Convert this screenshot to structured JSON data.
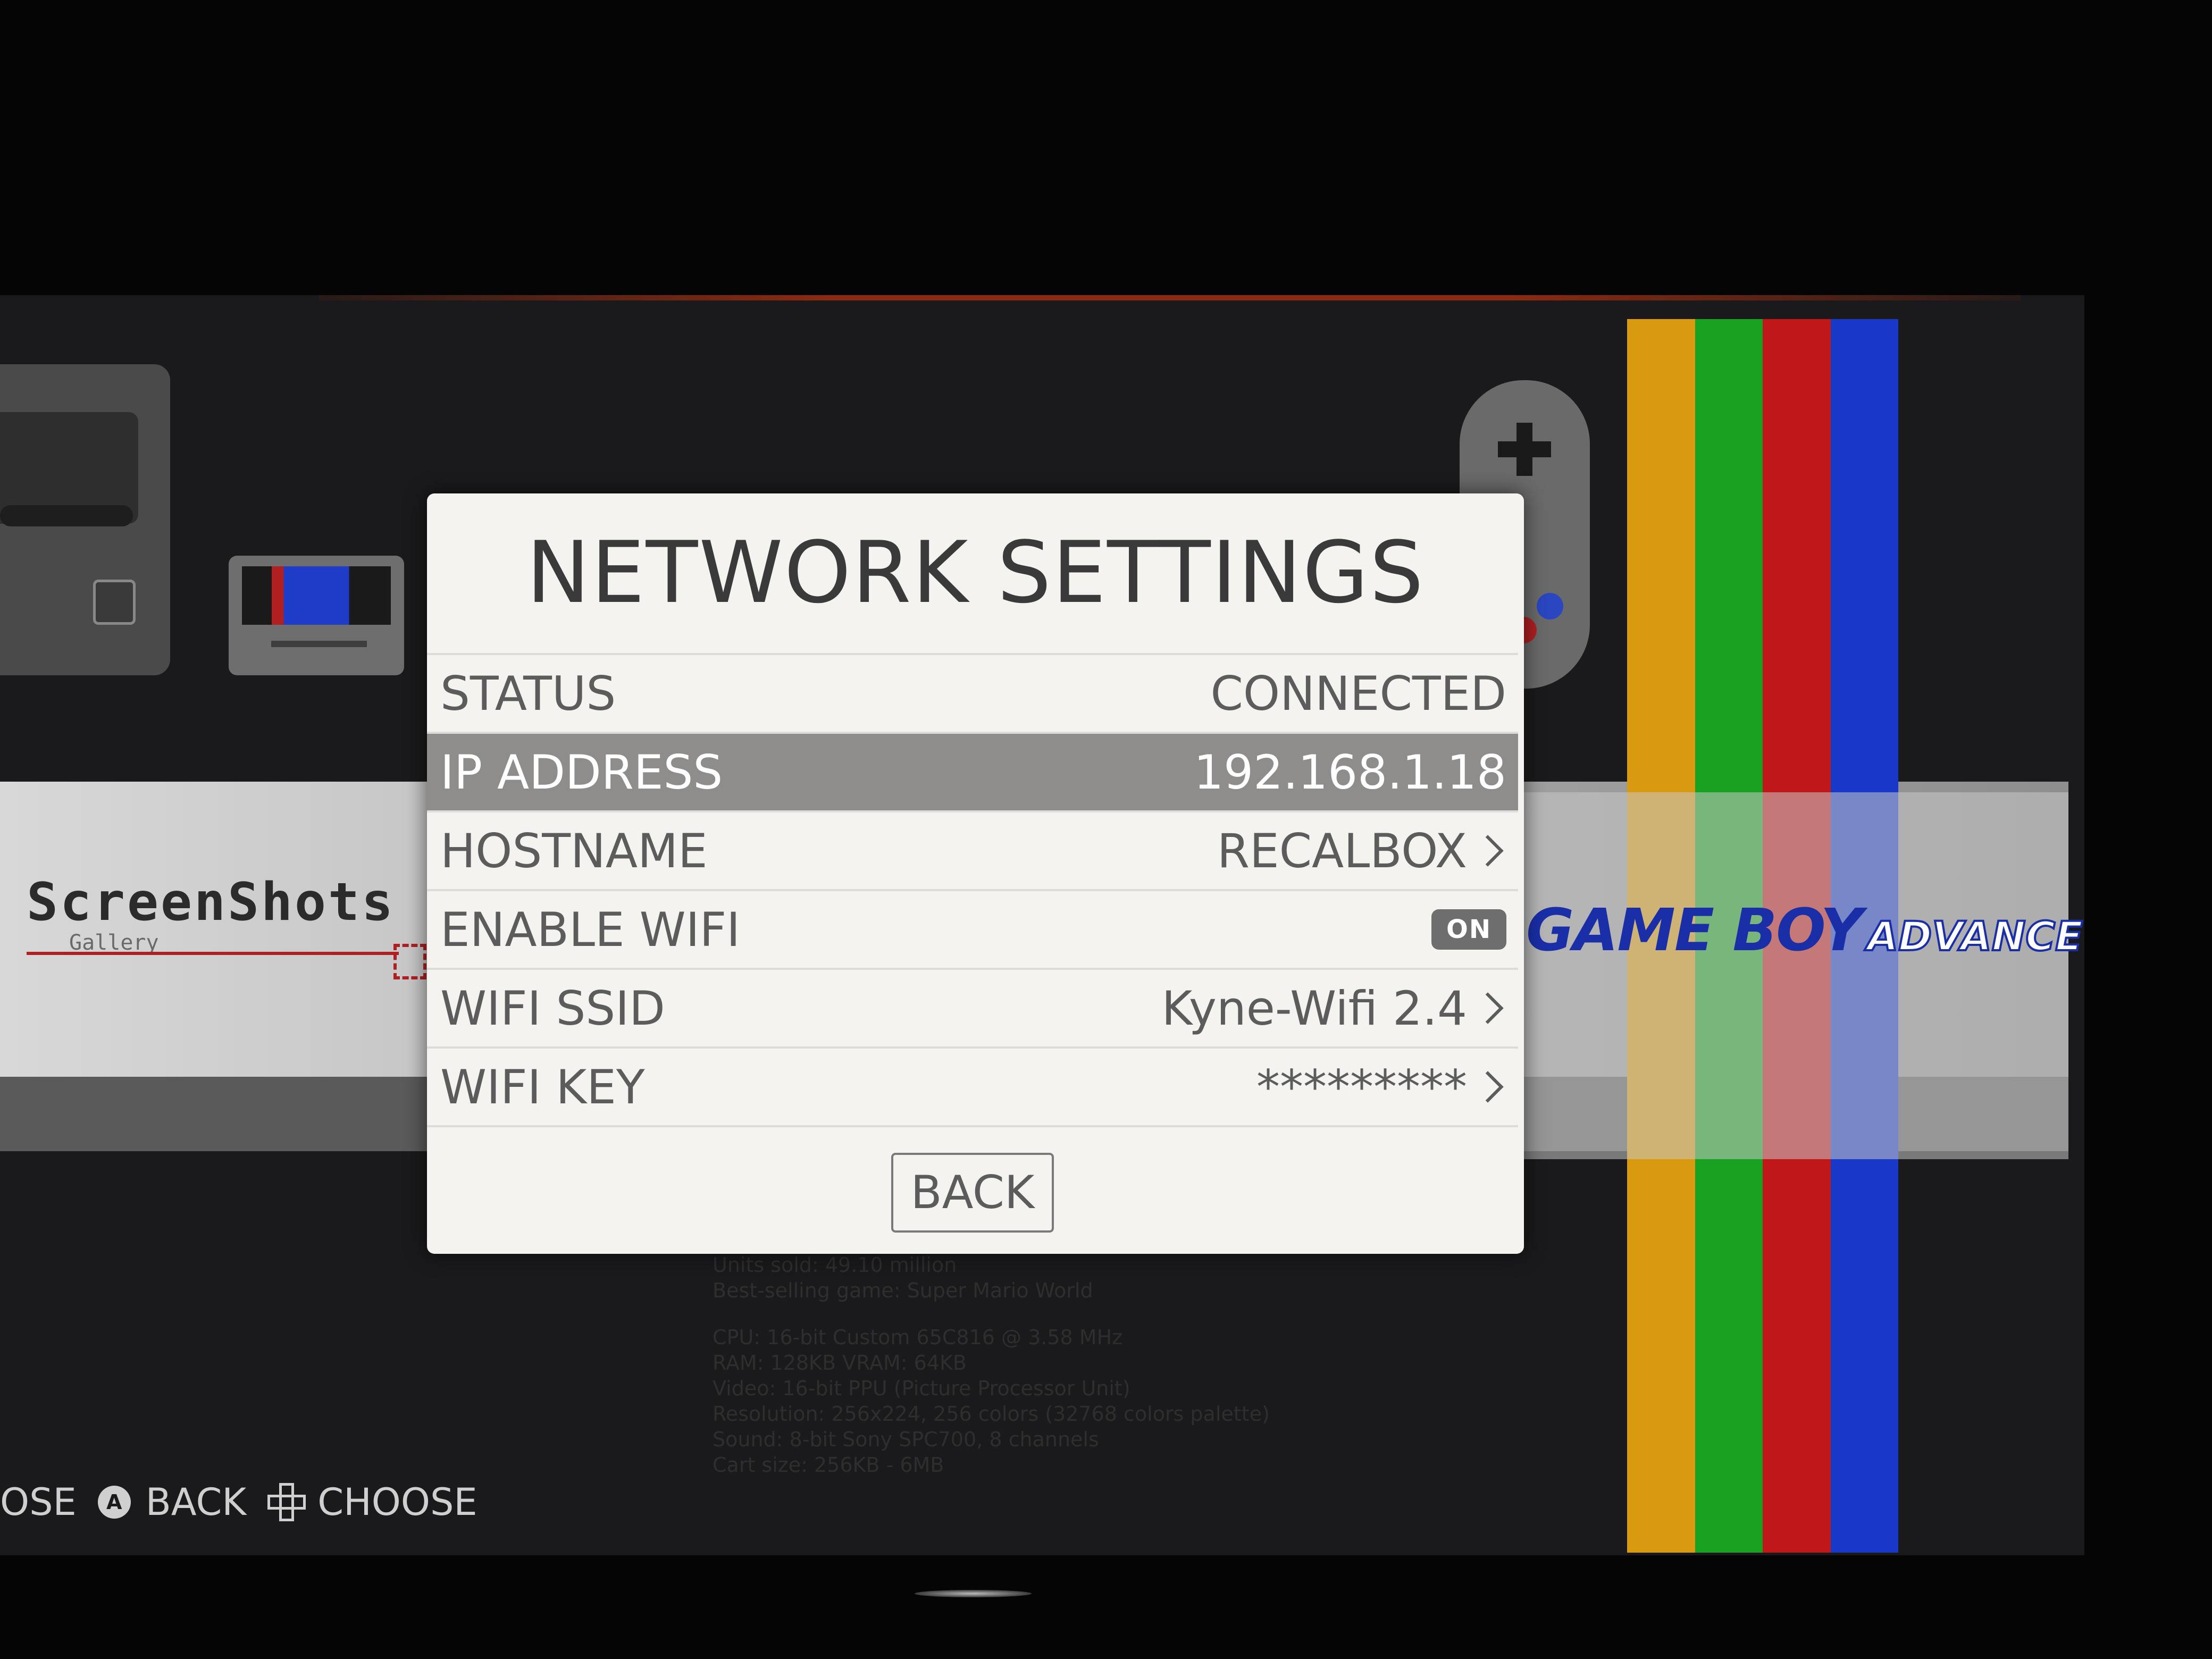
{
  "modal": {
    "title": "NETWORK SETTINGS",
    "rows": [
      {
        "label": "STATUS",
        "value": "CONNECTED"
      },
      {
        "label": "IP ADDRESS",
        "value": "192.168.1.18"
      },
      {
        "label": "HOSTNAME",
        "value": "RECALBOX"
      },
      {
        "label": "ENABLE WIFI",
        "value": "ON"
      },
      {
        "label": "WIFI SSID",
        "value": "Kyne-Wifi 2.4"
      },
      {
        "label": "WIFI KEY",
        "value": "*********"
      }
    ],
    "back_label": "BACK"
  },
  "background": {
    "gallery_logo": {
      "title": "ScreenShots",
      "subtitle": "Gallery"
    },
    "gba_logo": {
      "main": "GAME BOY",
      "sub": "ADVANCE"
    },
    "system_info": [
      "Units sold: 49.10 million",
      "Best-selling game: Super Mario World",
      "CPU: 16-bit Custom 65C816 @ 3.58 MHz",
      "RAM: 128KB VRAM: 64KB",
      "Video: 16-bit PPU (Picture Processor Unit)",
      "Resolution: 256x224, 256 colors (32768 colors palette)",
      "Sound: 8-bit Sony SPC700, 8 channels",
      "Cart size: 256KB - 6MB"
    ],
    "stripe_colors": [
      "#d89a10",
      "#18a020",
      "#c01818",
      "#1838c8"
    ]
  },
  "help_bar": {
    "items": [
      {
        "text": "OSE"
      },
      {
        "icon": "a-button-icon",
        "glyph": "A",
        "text": "BACK"
      },
      {
        "icon": "dpad-icon",
        "text": "CHOOSE"
      }
    ]
  },
  "colors": {
    "modal_bg": "#f4f3f0",
    "selected_row": "#8e8d8b",
    "text": "#5c5c5c",
    "title": "#3a3a3a"
  }
}
